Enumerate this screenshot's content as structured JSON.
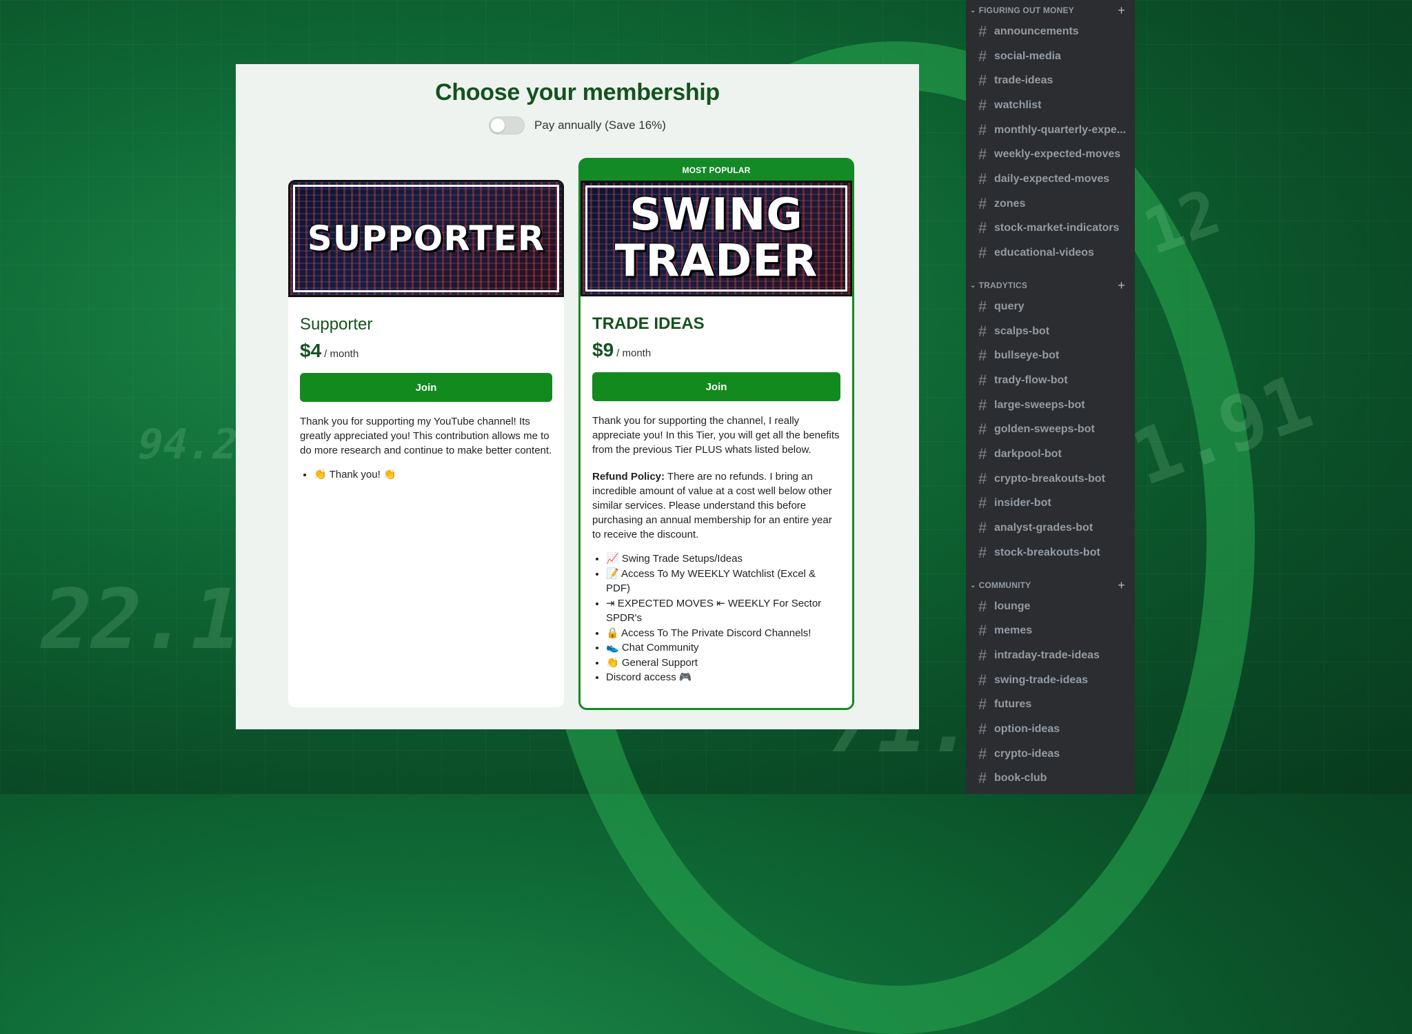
{
  "modal": {
    "title": "Choose your membership",
    "toggle_label": "Pay annually (Save 16%)",
    "toggle_on": false
  },
  "tiers": [
    {
      "banner_text": "SUPPORTER",
      "name": "Supporter",
      "price": "$4",
      "period": "/ month",
      "join_label": "Join",
      "description": "Thank you for supporting my YouTube channel! Its greatly appreciated you! This contribution allows me to do more research and continue to make better content.",
      "benefits": [
        "👏 Thank you! 👏"
      ]
    },
    {
      "badge": "MOST POPULAR",
      "banner_line1": "SWING",
      "banner_line2": "TRADER",
      "name": "TRADE IDEAS",
      "price": "$9",
      "period": "/ month",
      "join_label": "Join",
      "description": "Thank you for supporting the channel, I really appreciate you! In this Tier, you will get all the benefits from the previous Tier PLUS whats listed below.",
      "refund_label": "Refund Policy:",
      "refund_text": " There are no refunds. I bring an incredible amount of value at a cost well below other similar services. Please understand this before purchasing an annual membership for an entire year to receive the discount.",
      "benefits": [
        "📈 Swing Trade Setups/Ideas",
        "📝 Access To My WEEKLY Watchlist (Excel & PDF)",
        "⇥ EXPECTED MOVES ⇤ WEEKLY For Sector SPDR's",
        "🔒 Access To The Private Discord Channels!",
        "👟 Chat Community",
        "👏 General Support",
        "Discord access 🎮"
      ]
    }
  ],
  "sidebar": {
    "categories": [
      {
        "name": "FIGURING OUT MONEY",
        "channels": [
          "announcements",
          "social-media",
          "trade-ideas",
          "watchlist",
          "monthly-quarterly-expe...",
          "weekly-expected-moves",
          "daily-expected-moves",
          "zones",
          "stock-market-indicators",
          "educational-videos"
        ]
      },
      {
        "name": "TRADYTICS",
        "channels": [
          "query",
          "scalps-bot",
          "bullseye-bot",
          "trady-flow-bot",
          "large-sweeps-bot",
          "golden-sweeps-bot",
          "darkpool-bot",
          "crypto-breakouts-bot",
          "insider-bot",
          "analyst-grades-bot",
          "stock-breakouts-bot"
        ]
      },
      {
        "name": "COMMUNITY",
        "channels": [
          "lounge",
          "memes",
          "intraday-trade-ideas",
          "swing-trade-ideas",
          "futures",
          "option-ideas",
          "crypto-ideas",
          "book-club"
        ]
      }
    ],
    "hash_glyph": "#",
    "add_glyph": "+",
    "collapse_glyph": "⌄"
  }
}
